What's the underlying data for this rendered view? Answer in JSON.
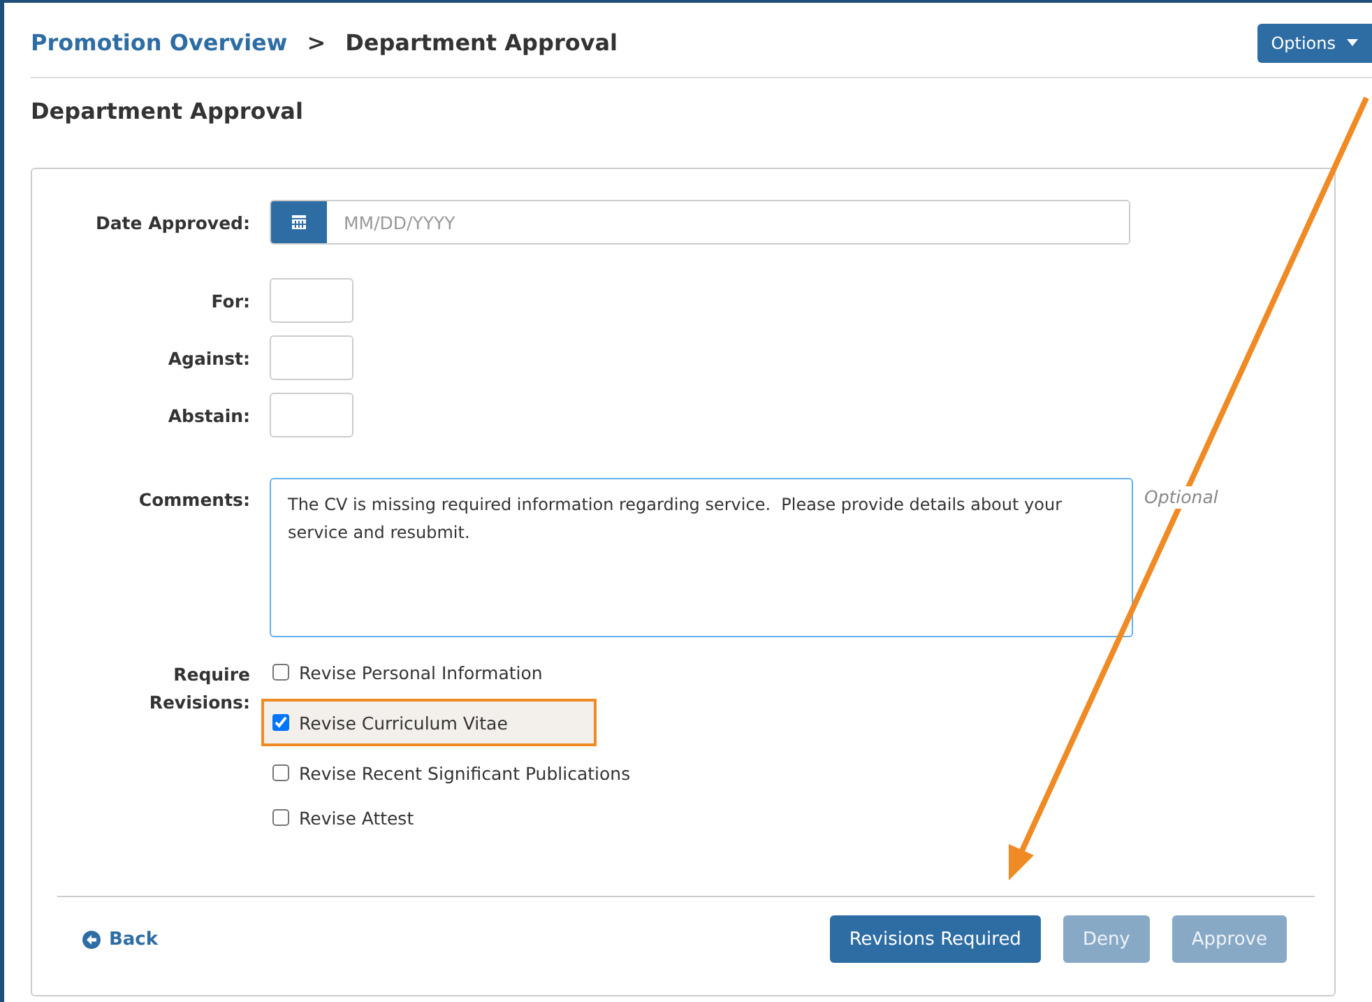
{
  "breadcrumb": {
    "link": "Promotion Overview",
    "separator": ">",
    "current": "Department Approval"
  },
  "options_button": {
    "label": "Options"
  },
  "page_title": "Department Approval",
  "form": {
    "date_approved": {
      "label": "Date Approved:",
      "placeholder": "MM/DD/YYYY"
    },
    "votes": [
      {
        "label": "For:"
      },
      {
        "label": "Against:"
      },
      {
        "label": "Abstain:"
      }
    ],
    "comments": {
      "label": "Comments:",
      "value": "The CV is missing required information regarding service.  Please provide details about your service and resubmit.",
      "hint": "Optional"
    },
    "revisions": {
      "label": "Require Revisions:",
      "items": [
        {
          "label": "Revise Personal Information",
          "checked": false,
          "highlighted": false
        },
        {
          "label": "Revise Curriculum Vitae",
          "checked": true,
          "highlighted": true
        },
        {
          "label": "Revise Recent Significant Publications",
          "checked": false,
          "highlighted": false
        },
        {
          "label": "Revise Attest",
          "checked": false,
          "highlighted": false
        }
      ]
    }
  },
  "footer": {
    "back": "Back",
    "buttons": [
      {
        "label": "Revisions Required",
        "disabled": false
      },
      {
        "label": "Deny",
        "disabled": true
      },
      {
        "label": "Approve",
        "disabled": true
      }
    ]
  }
}
